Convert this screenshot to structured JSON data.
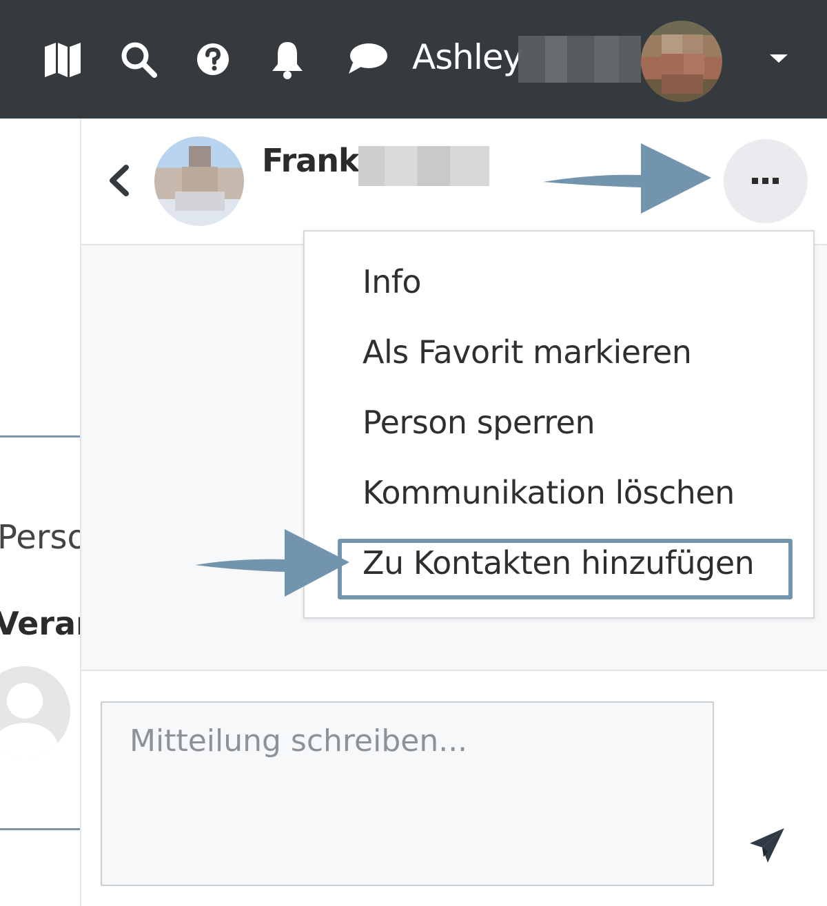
{
  "navbar": {
    "icons": [
      "map-icon",
      "search-icon",
      "help-icon",
      "bell-icon",
      "chat-icon",
      "caret-down-icon"
    ],
    "username": "Ashley"
  },
  "background_page": {
    "text_1": "Perso",
    "text_2": "Veran"
  },
  "chat": {
    "contact_name": "Frank",
    "more_icon": "ellipsis-icon",
    "back_icon": "chevron-left-icon",
    "menu": [
      {
        "label": "Info"
      },
      {
        "label": "Als Favorit markieren"
      },
      {
        "label": "Person sperren"
      },
      {
        "label": "Kommunikation löschen"
      },
      {
        "label": "Zu Kontakten hinzufügen"
      }
    ],
    "compose": {
      "placeholder": "Mitteilung schreiben...",
      "value": "",
      "send_icon": "paper-plane-icon"
    }
  },
  "colors": {
    "navbar": "#353a3f",
    "annotation": "#7394ad",
    "drawer_bg": "#f7f8fa"
  }
}
